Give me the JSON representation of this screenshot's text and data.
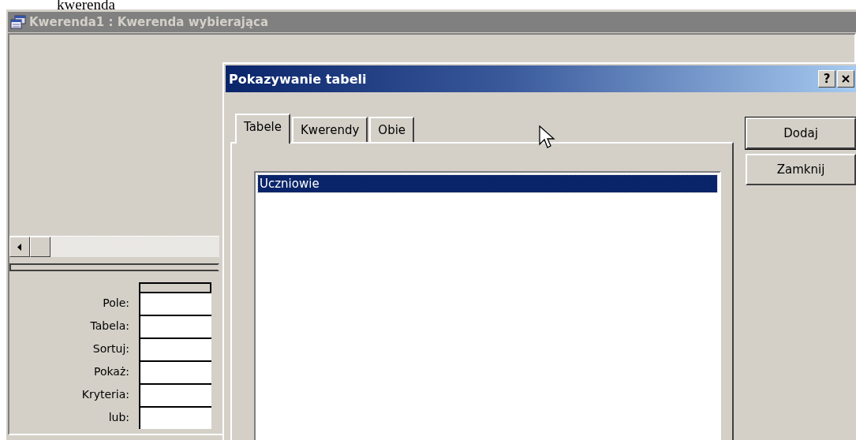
{
  "document_text": "kwerenda",
  "window": {
    "title": "Kwerenda1 : Kwerenda wybierająca",
    "active": false
  },
  "design_grid": {
    "rows": [
      "Pole:",
      "Tabela:",
      "Sortuj:",
      "Pokaż:",
      "Kryteria:",
      "lub:"
    ]
  },
  "dialog": {
    "title": "Pokazywanie tabeli",
    "help_button": "?",
    "tabs": [
      {
        "label": "Tabele",
        "selected": true
      },
      {
        "label": "Kwerendy",
        "selected": false
      },
      {
        "label": "Obie",
        "selected": false
      }
    ],
    "items": [
      {
        "label": "Uczniowie",
        "selected": true
      }
    ],
    "buttons": [
      {
        "label": "Dodaj",
        "default": true
      },
      {
        "label": "Zamknij",
        "default": false
      }
    ]
  }
}
